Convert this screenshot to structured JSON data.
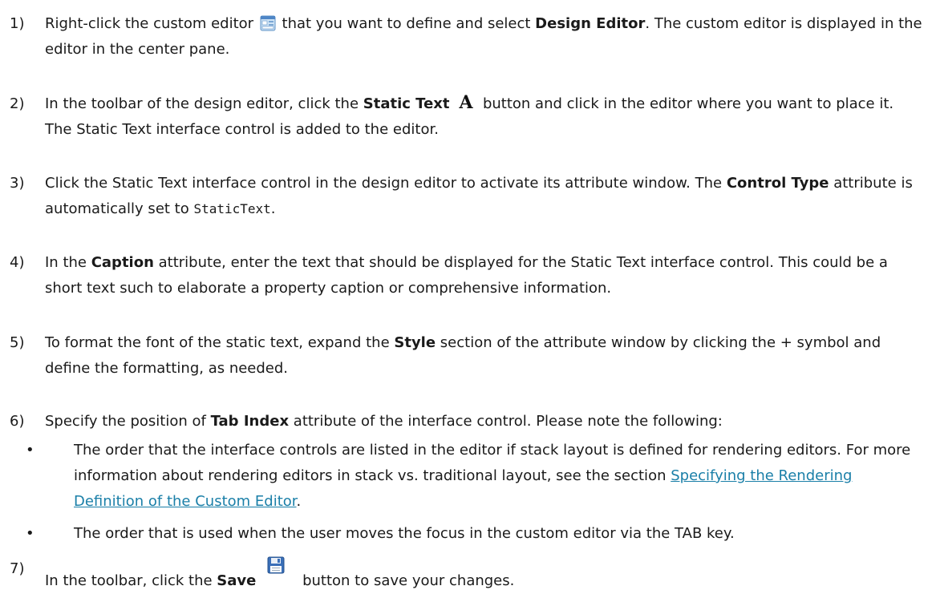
{
  "steps": [
    {
      "num": "1)",
      "a": "Right-click the custom editor ",
      "b": " that you want to define and select ",
      "bold": "Design Editor",
      "c": ". The custom editor is displayed in the editor in the center pane."
    },
    {
      "num": "2)",
      "a": "In the toolbar of the design editor, click the ",
      "bold": "Static Text",
      "b": " button and click in the editor where you want to place it. The Static Text interface control is added to the editor."
    },
    {
      "num": "3)",
      "a": "Click the Static Text interface control in the design editor to activate its attribute window. The ",
      "bold": "Control Type",
      "b": " attribute is automatically set to ",
      "code": "StaticText",
      "c": "."
    },
    {
      "num": "4)",
      "a": "In the ",
      "bold": "Caption",
      "b": " attribute, enter the text that should be displayed for the Static Text interface control. This could be a short text such to elaborate a property caption or comprehensive information."
    },
    {
      "num": "5)",
      "a": "To format the font of the static text, expand the ",
      "bold": "Style",
      "b": " section of the attribute window by clicking the + symbol and define the formatting, as needed."
    },
    {
      "num": "6)",
      "a": "Specify the position of ",
      "bold": "Tab Index",
      "b": " attribute of the interface control. Please note the following:"
    },
    {
      "num": "7)",
      "a": "In the toolbar, click the ",
      "bold": "Save",
      "b": " button to save your changes."
    }
  ],
  "bullets": [
    {
      "dot": "•",
      "a": "The order that the interface controls are listed in the editor if stack layout is defined for rendering editors. For more information about rendering editors in stack vs. traditional layout, see the section ",
      "link": "Specifying the Rendering Definition of the Custom Editor",
      "b": "."
    },
    {
      "dot": "•",
      "a": "The order that is used when the user moves the focus in the custom editor via the TAB key."
    }
  ],
  "icons": {
    "editor": "custom-editor-icon",
    "static_text": "static-text-icon",
    "save": "save-icon"
  },
  "colors": {
    "text": "#1a1a1a",
    "link": "#1a7fa8"
  }
}
